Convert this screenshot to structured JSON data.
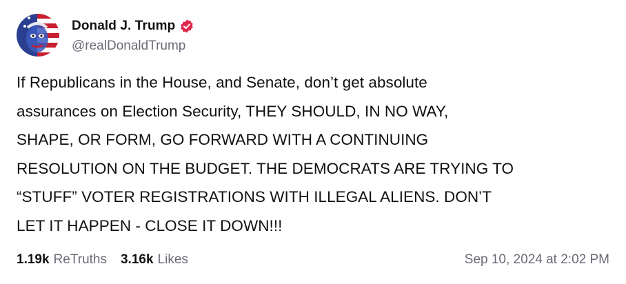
{
  "author": {
    "display_name": "Donald J. Trump",
    "handle": "@realDonaldTrump",
    "verified_badge_icon": "verified-badge-icon",
    "verified_color": "#e0264b",
    "avatar_icon": "profile-avatar-flag-portrait"
  },
  "post": {
    "text": "If Republicans in the House, and Senate, don’t get absolute\nassurances on Election Security, THEY SHOULD, IN NO WAY,\nSHAPE, OR FORM, GO FORWARD WITH A CONTINUING\nRESOLUTION ON THE BUDGET. THE DEMOCRATS ARE TRYING TO\n“STUFF” VOTER REGISTRATIONS WITH ILLEGAL ALIENS. DON’T\nLET IT HAPPEN - CLOSE IT DOWN!!!"
  },
  "stats": {
    "retruths_count": "1.19k",
    "retruths_label": "ReTruths",
    "likes_count": "3.16k",
    "likes_label": "Likes"
  },
  "timestamp": "Sep 10, 2024 at 2:02 PM",
  "colors": {
    "text": "#111111",
    "muted": "#6b6b78",
    "background": "#ffffff"
  }
}
